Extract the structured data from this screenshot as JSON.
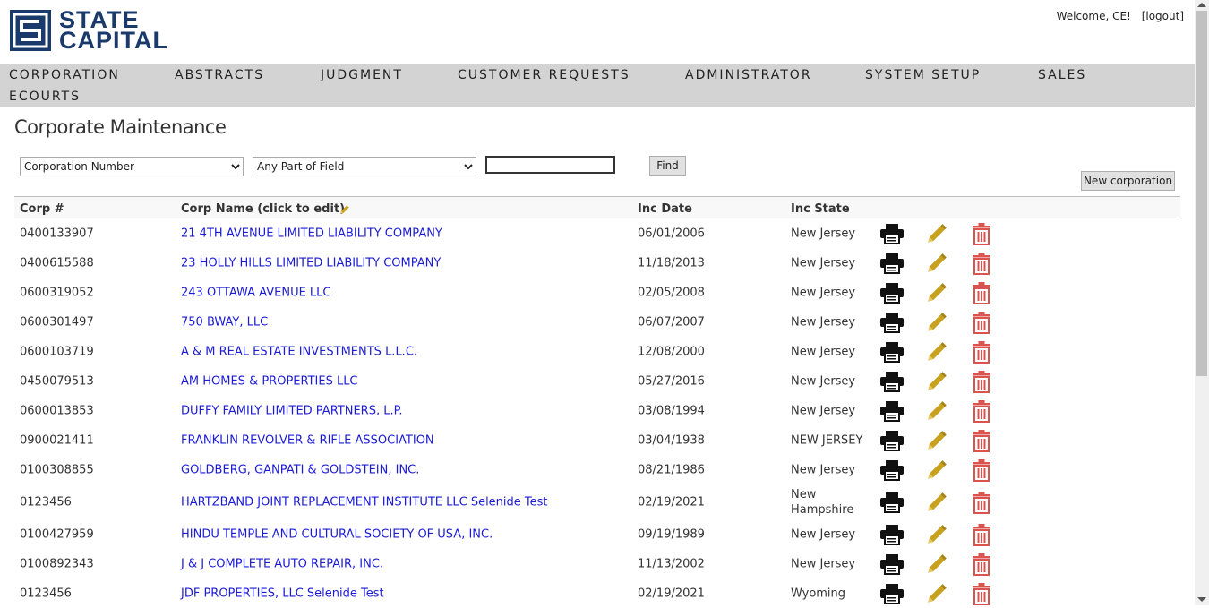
{
  "logo": {
    "line1": "STATE",
    "line2": "CAPITAL"
  },
  "header": {
    "welcome": "Welcome, CE!",
    "logout": "[logout]"
  },
  "nav": [
    "CORPORATION",
    "ABSTRACTS",
    "JUDGMENT",
    "CUSTOMER REQUESTS",
    "ADMINISTRATOR",
    "SYSTEM SETUP",
    "SALES",
    "ECOURTS"
  ],
  "page_title": "Corporate Maintenance",
  "filters": {
    "field_selected": "Corporation Number",
    "match_selected": "Any Part of Field",
    "search_value": "",
    "find_label": "Find",
    "new_label": "New corporation"
  },
  "columns": {
    "corp": "Corp #",
    "name": "Corp Name (click to edit)",
    "date": "Inc Date",
    "state": "Inc State"
  },
  "rows": [
    {
      "corp": "0400133907",
      "name": "21 4TH AVENUE LIMITED LIABILITY COMPANY",
      "date": "06/01/2006",
      "state": "New Jersey"
    },
    {
      "corp": "0400615588",
      "name": "23 HOLLY HILLS LIMITED LIABILITY COMPANY",
      "date": "11/18/2013",
      "state": "New Jersey"
    },
    {
      "corp": "0600319052",
      "name": "243 OTTAWA AVENUE LLC",
      "date": "02/05/2008",
      "state": "New Jersey"
    },
    {
      "corp": "0600301497",
      "name": "750 BWAY, LLC",
      "date": "06/07/2007",
      "state": "New Jersey"
    },
    {
      "corp": "0600103719",
      "name": "A & M REAL ESTATE INVESTMENTS L.L.C.",
      "date": "12/08/2000",
      "state": "New Jersey"
    },
    {
      "corp": "0450079513",
      "name": "AM HOMES & PROPERTIES LLC",
      "date": "05/27/2016",
      "state": "New Jersey"
    },
    {
      "corp": "0600013853",
      "name": "DUFFY FAMILY LIMITED PARTNERS, L.P.",
      "date": "03/08/1994",
      "state": "New Jersey"
    },
    {
      "corp": "0900021411",
      "name": "FRANKLIN REVOLVER & RIFLE ASSOCIATION",
      "date": "03/04/1938",
      "state": "NEW JERSEY"
    },
    {
      "corp": "0100308855",
      "name": "GOLDBERG, GANPATI & GOLDSTEIN, INC.",
      "date": "08/21/1986",
      "state": "New Jersey"
    },
    {
      "corp": "0123456",
      "name": "HARTZBAND JOINT REPLACEMENT INSTITUTE LLC Selenide Test",
      "date": "02/19/2021",
      "state": "New Hampshire"
    },
    {
      "corp": "0100427959",
      "name": "HINDU TEMPLE AND CULTURAL SOCIETY OF USA, INC.",
      "date": "09/19/1989",
      "state": "New Jersey"
    },
    {
      "corp": "0100892343",
      "name": "J & J COMPLETE AUTO REPAIR, INC.",
      "date": "11/13/2002",
      "state": "New Jersey"
    },
    {
      "corp": "0123456",
      "name": "JDF PROPERTIES, LLC Selenide Test",
      "date": "02/19/2021",
      "state": "Wyoming"
    }
  ],
  "colors": {
    "link": "#1b1bd6",
    "pencil": "#c8a21e",
    "trash": "#d9534f",
    "nav_bg": "#d3d3d3",
    "brand": "#1a3a6b"
  },
  "icons": {
    "print": "printer-icon",
    "edit": "pencil-icon",
    "delete": "trash-icon"
  }
}
